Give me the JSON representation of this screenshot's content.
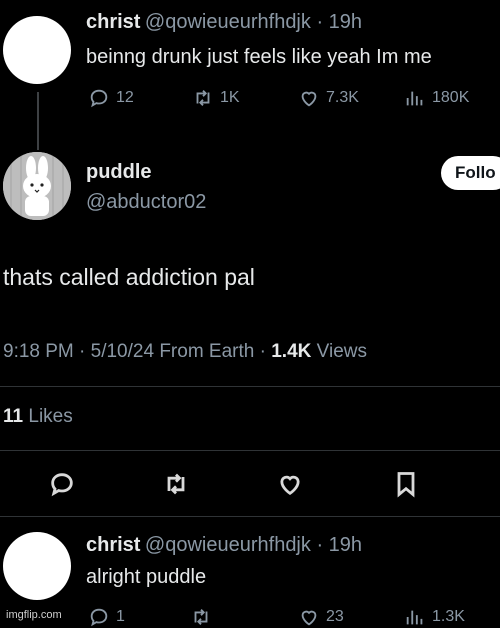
{
  "parent_tweet": {
    "name": "christ",
    "handle": "@qowieueurhfhdjk",
    "time": "19h",
    "text": "beinng drunk just feels like yeah Im me",
    "replies": "12",
    "retweets": "1K",
    "likes": "7.3K",
    "views": "180K"
  },
  "main_tweet": {
    "name": "puddle",
    "handle": "@abductor02",
    "follow_label": "Follo",
    "text": "thats called addiction pal",
    "meta_prefix": "9:18 PM · 5/10/24 From Earth · ",
    "views_count": "1.4K",
    "views_label": " Views",
    "likes_count": "11",
    "likes_label": " Likes"
  },
  "reply_tweet": {
    "name": "christ",
    "handle": "@qowieueurhfhdjk",
    "time": "19h",
    "text": "alright puddle",
    "replies": "1",
    "likes": "23",
    "views": "1.3K"
  },
  "watermark": "imgflip.com"
}
